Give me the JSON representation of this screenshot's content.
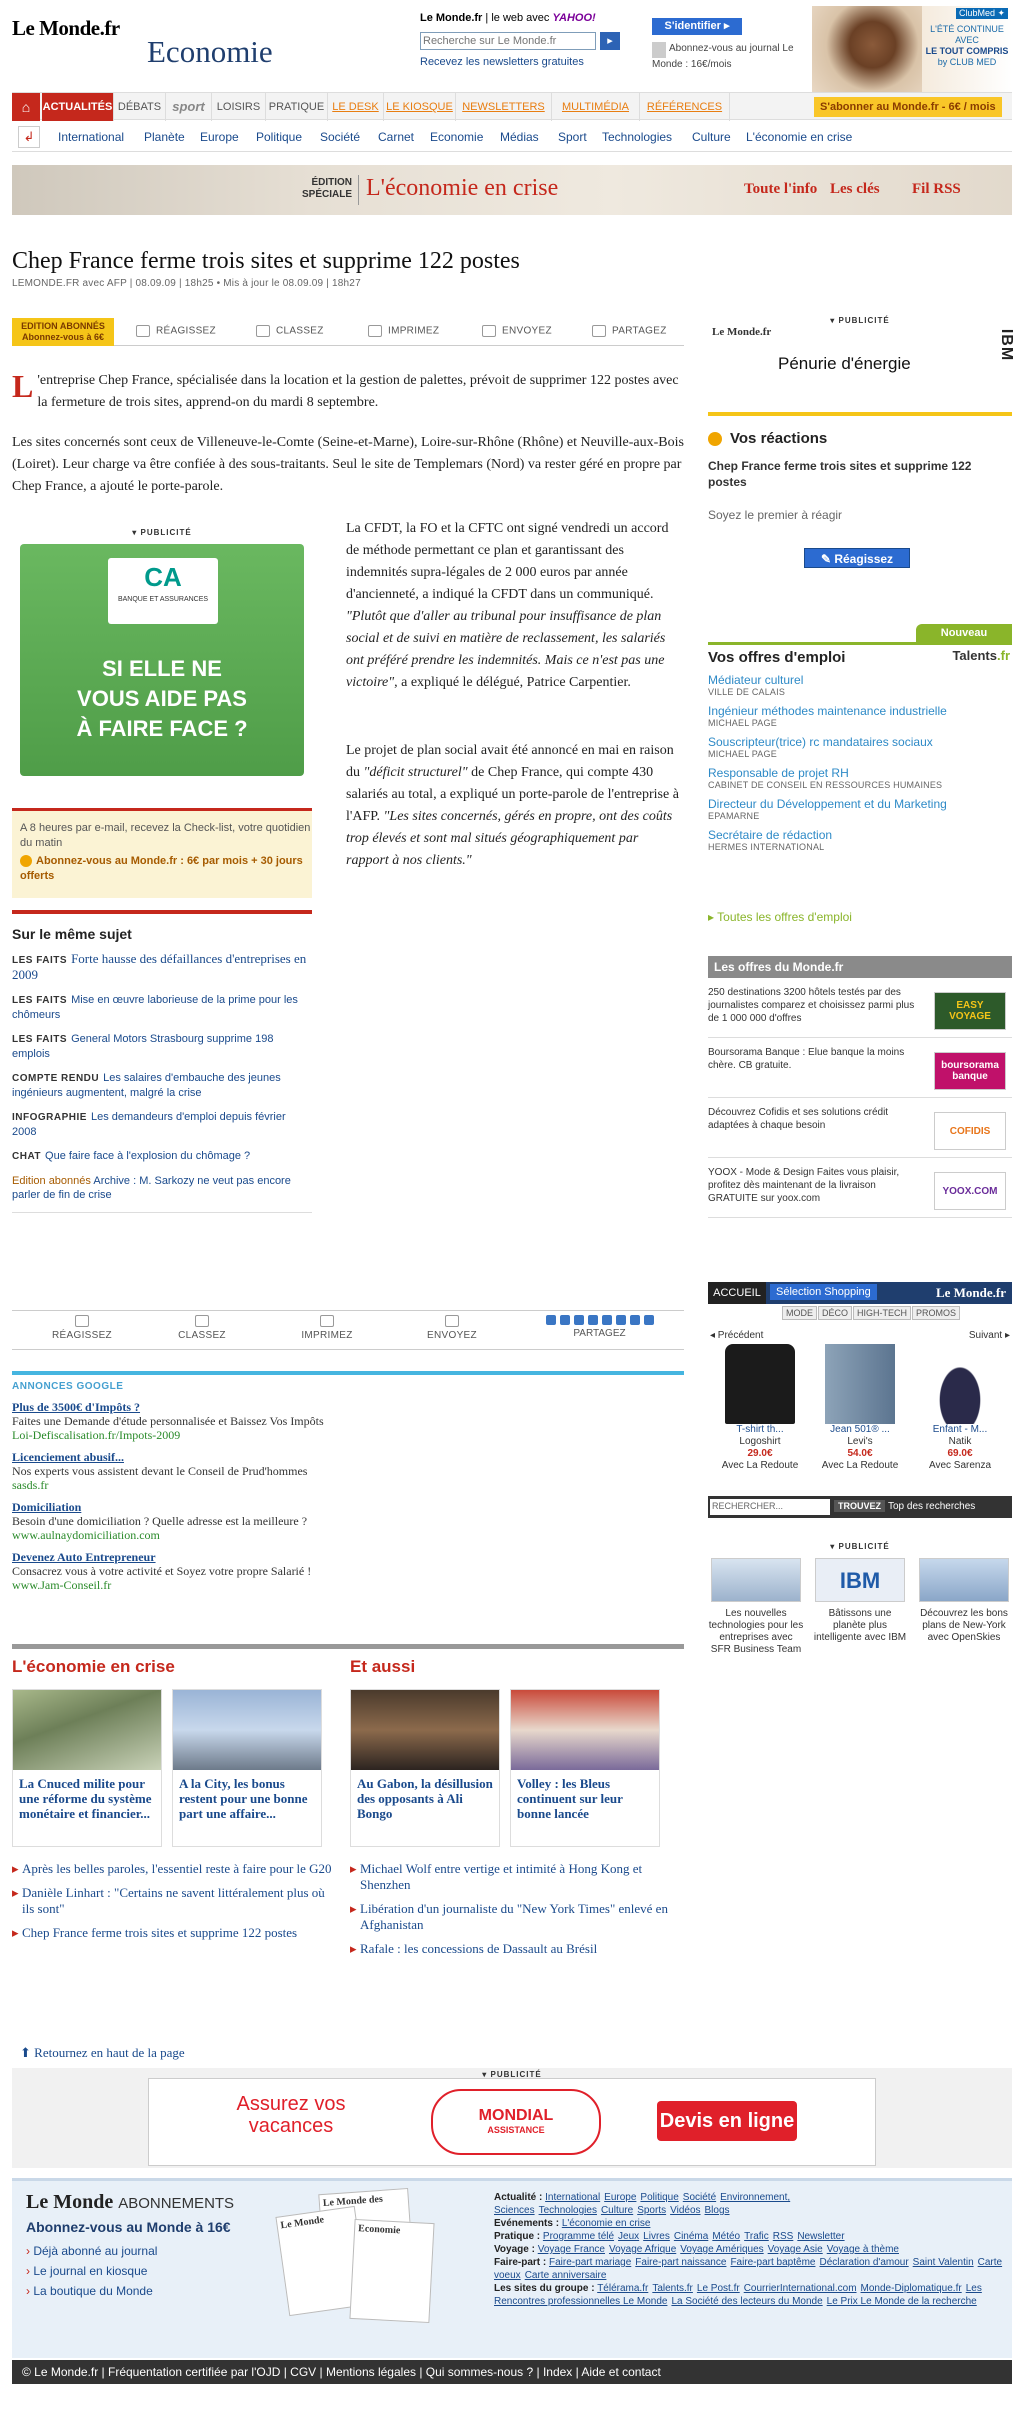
{
  "header": {
    "logo": "Le Monde.fr",
    "section": "Economie",
    "site_label": "Le Monde.fr",
    "web_label": "le web avec",
    "yahoo": "YAHOO!",
    "search_placeholder": "Recherche sur Le Monde.fr",
    "search_button": "▸",
    "newsletters": "Recevez les newsletters gratuites",
    "identify": "S'identifier ▸",
    "subscribe_text": "Abonnez-vous au journal Le Monde : 16€/mois",
    "ad": {
      "tag": "ClubMed ✦",
      "l1": "L'ÉTÉ CONTINUE",
      "l2": "AVEC",
      "l3": "LE TOUT COMPRIS",
      "l4": "by CLUB MED"
    }
  },
  "nav": {
    "home_icon": "⌂",
    "tabs": [
      "ACTUALITÉS",
      "DÉBATS",
      "sport",
      "LOISIRS",
      "PRATIQUE",
      "LE DESK",
      "LE KIOSQUE",
      "NEWSLETTERS",
      "MULTIMÉDIA",
      "RÉFÉRENCES"
    ],
    "subscribe": "S'abonner au Monde.fr - 6€ / mois"
  },
  "subnav": {
    "back_icon": "↲",
    "items": [
      "International",
      "Planète",
      "Europe",
      "Politique",
      "Société",
      "Carnet",
      "Economie",
      "Médias",
      "Sport",
      "Technologies",
      "Culture",
      "L'économie en crise"
    ]
  },
  "banner": {
    "edition": "ÉDITION SPÉCIALE",
    "title": "L'économie en crise",
    "links": [
      "Toute l'info",
      "Les clés",
      "Fil RSS"
    ]
  },
  "article": {
    "title": "Chep France ferme trois sites et supprime 122 postes",
    "byline": "LEMONDE.FR avec AFP | 08.09.09 | 18h25  •  Mis à jour le 08.09.09 | 18h27",
    "toolbar": {
      "edition": "EDITION ABONNÉS Abonnez-vous à 6€",
      "actions": [
        "RÉAGISSEZ",
        "CLASSEZ",
        "IMPRIMEZ",
        "ENVOYEZ",
        "PARTAGEZ"
      ]
    },
    "dropcap": "L",
    "p1": "'entreprise Chep France, spécialisée dans la location et la gestion de palettes, prévoit de supprimer 122 postes avec la fermeture de trois sites, apprend-on du mardi 8 septembre.",
    "p2": "Les sites concernés sont ceux de Villeneuve-le-Comte (Seine-et-Marne), Loire-sur-Rhône (Rhône) et Neuville-aux-Bois (Loiret). Leur charge va être confiée à des sous-traitants. Seul le site de Templemars (Nord) va rester géré en propre par Chep France, a ajouté le porte-parole.",
    "p3_a": "La CFDT, la FO et la CFTC ont signé vendredi un accord de méthode permettant ce plan et garantissant des indemnités supra-légales de 2 000 euros par année d'ancienneté, a indiqué la CFDT dans un communiqué. ",
    "p3_q": "\"Plutôt que d'aller au tribunal pour insuffisance de plan social et de suivi en matière de reclassement, les salariés ont préféré prendre les indemnités. Mais ce n'est pas une victoire\"",
    "p3_b": ", a expliqué le délégué, Patrice Carpentier.",
    "p4_a": "Le projet de plan social avait été annoncé en mai en raison du ",
    "p4_q1": "\"déficit structurel\"",
    "p4_b": " de Chep France, qui compte 430 salariés au total, a expliqué un porte-parole de l'entreprise à l'AFP. ",
    "p4_q2": "\"Les sites concernés, gérés en propre, ont des coûts trop élevés et sont mal situés géographiquement par rapport à nos clients.\""
  },
  "ad_ca": {
    "pub": "PUBLICITÉ",
    "logo": "CA",
    "logo_sub": "BANQUE ET ASSURANCES",
    "slogan_1": "SI ELLE NE",
    "slogan_2": "VOUS AIDE PAS",
    "slogan_3": "À FAIRE FACE ?"
  },
  "promo": {
    "text": "A 8 heures par e-mail, recevez la Check-list, votre quotidien du matin",
    "offer": "Abonnez-vous au Monde.fr : 6€ par mois + 30 jours offerts"
  },
  "same_subject": {
    "heading": "Sur le même sujet",
    "items": [
      {
        "kind": "LES FAITS",
        "text": "Forte hausse des défaillances d'entreprises en 2009"
      },
      {
        "kind": "LES FAITS",
        "text": "Mise en œuvre laborieuse de la prime pour les chômeurs"
      },
      {
        "kind": "LES FAITS",
        "text": "General Motors Strasbourg supprime 198 emplois"
      },
      {
        "kind": "COMPTE RENDU",
        "text": "Les salaires d'embauche des jeunes ingénieurs augmentent, malgré la crise"
      },
      {
        "kind": "INFOGRAPHIE",
        "text": "Les demandeurs d'emploi depuis février 2008"
      },
      {
        "kind": "CHAT",
        "text": "Que faire face à l'explosion du chômage ?"
      }
    ],
    "abonnes": "Edition abonnés",
    "abonnes_text": "Archive : M. Sarkozy ne veut pas encore parler de fin de crise"
  },
  "toolbar2": {
    "actions": [
      "RÉAGISSEZ",
      "CLASSEZ",
      "IMPRIMEZ",
      "ENVOYEZ"
    ],
    "share": "PARTAGEZ"
  },
  "google": {
    "heading": "ANNONCES GOOGLE",
    "ads": [
      {
        "title": "Plus de 3500€ d'Impôts ?",
        "text": "Faites une Demande d'étude personnalisée et Baissez Vos Impôts",
        "url": "Loi-Defiscalisation.fr/Impots-2009"
      },
      {
        "title": "Licenciement abusif...",
        "text": "Nos experts vous assistent devant le Conseil de Prud'hommes",
        "url": "sasds.fr"
      },
      {
        "title": "Domiciliation",
        "text": "Besoin d'une domiciliation ? Quelle adresse est la meilleure ?",
        "url": "www.aulnaydomiciliation.com"
      },
      {
        "title": "Devenez Auto Entrepreneur",
        "text": "Consacrez vous à votre activité et Soyez votre propre Salarié !",
        "url": "www.Jam-Conseil.fr"
      }
    ]
  },
  "bottom_news": {
    "eco_heading": "L'économie en crise",
    "aussi_heading": "Et aussi",
    "cards": [
      "La Cnuced milite pour une réforme du système monétaire et financier...",
      "A la City, les bonus restent pour une bonne part une affaire...",
      "Au Gabon, la désillusion des opposants à Ali Bongo",
      "Volley : les Bleus continuent sur leur bonne lancée"
    ],
    "eco_list": [
      "Après les belles paroles, l'essentiel reste à faire pour le G20",
      "Danièle Linhart : \"Certains ne savent littéralement plus où ils sont\"",
      "Chep France ferme trois sites et supprime 122 postes"
    ],
    "aussi_list": [
      "Michael Wolf entre vertige et intimité à Hong Kong et Shenzhen",
      "Libération d'un journaliste du \"New York Times\" enlevé en Afghanistan",
      "Rafale : les concessions de Dassault au Brésil"
    ]
  },
  "back_top": "Retournez en haut de la page",
  "bottom_ad": {
    "pub": "PUBLICITÉ",
    "left": "Assurez vos vacances",
    "brand": "MONDIAL",
    "brand_sub": "ASSISTANCE",
    "cta": "Devis en ligne"
  },
  "footer": {
    "logo": "Le Monde",
    "abonnements": "ABONNEMENTS",
    "offer": "Abonnez-vous au Monde à 16€",
    "links": [
      "Déjà abonné au journal",
      "Le journal en kiosque",
      "La boutique du Monde"
    ],
    "mag1": "Le Monde",
    "mag2": "Economie",
    "mag3": "Le Monde des Livres",
    "right": [
      {
        "label": "Actualité :",
        "links": [
          "International",
          "Europe",
          "Politique",
          "Société",
          "Environnement, Sciences",
          "Technologies",
          "Culture",
          "Sports",
          "Vidéos",
          "Blogs"
        ]
      },
      {
        "label": "Evénements :",
        "links": [
          "L'économie en crise"
        ]
      },
      {
        "label": "Pratique :",
        "links": [
          "Programme télé",
          "Jeux",
          "Livres",
          "Cinéma",
          "Météo",
          "Trafic",
          "RSS",
          "Newsletter"
        ]
      },
      {
        "label": "Voyage :",
        "links": [
          "Voyage France",
          "Voyage Afrique",
          "Voyage Amériques",
          "Voyage Asie",
          "Voyage à thème"
        ]
      },
      {
        "label": "Faire-part :",
        "links": [
          "Faire-part mariage",
          "Faire-part naissance",
          "Faire-part baptême",
          "Déclaration d'amour",
          "Saint Valentin",
          "Carte voeux",
          "Carte anniversaire"
        ]
      },
      {
        "label": "Les sites du groupe :",
        "links": [
          "Télérama.fr",
          "Talents.fr",
          "Le Post.fr",
          "CourrierInternational.com",
          "Monde-Diplomatique.fr",
          "Les Rencontres professionnelles Le Monde",
          "La Société des lecteurs du Monde",
          "Le Prix Le Monde de la recherche"
        ]
      }
    ]
  },
  "copyright": "© Le Monde.fr | Fréquentation certifiée par l'OJD | CGV | Mentions légales | Qui sommes-nous ? | Index | Aide et contact",
  "right": {
    "pub": "PUBLICITÉ",
    "energy_logo": "Le Monde.fr",
    "energy": "Pénurie d'énergie",
    "ibm": "IBM",
    "reactions": {
      "heading": "Vos réactions",
      "title": "Chep France ferme trois sites et supprime 122 postes",
      "sub": "Soyez le premier à réagir",
      "button": "Réagissez"
    },
    "jobs": {
      "new": "Nouveau",
      "heading": "Vos offres d'emploi",
      "talents": "Talents",
      "talents_ext": ".fr",
      "items": [
        {
          "title": "Médiateur culturel",
          "company": "VILLE DE CALAIS"
        },
        {
          "title": "Ingénieur méthodes maintenance industrielle",
          "company": "MICHAEL PAGE"
        },
        {
          "title": "Souscripteur(trice) rc mandataires sociaux",
          "company": "MICHAEL PAGE"
        },
        {
          "title": "Responsable de projet RH",
          "company": "CABINET DE CONSEIL EN RESSOURCES HUMAINES"
        },
        {
          "title": "Directeur du Développement et du Marketing",
          "company": "EPAMARNE"
        },
        {
          "title": "Secrétaire de rédaction",
          "company": "HERMES INTERNATIONAL"
        }
      ],
      "all": "Toutes les offres d'emploi"
    },
    "offres": {
      "heading": "Les offres du Monde.fr",
      "items": [
        {
          "text": "250 destinations 3200 hôtels testés par des journalistes comparez et choisissez parmi plus de 1 000 000 d'offres",
          "logo": "EASY VOYAGE"
        },
        {
          "text": "Boursorama Banque : Elue banque la moins chère. CB gratuite.",
          "logo": "boursorama banque"
        },
        {
          "text": "Découvrez Cofidis et ses solutions crédit adaptées à chaque besoin",
          "logo": "COFIDIS"
        },
        {
          "text": "YOOX - Mode & Design Faites vous plaisir, profitez dès maintenant de la livraison GRATUITE sur yoox.com",
          "logo": "YOOX.COM"
        }
      ]
    },
    "shop": {
      "accueil": "ACCUEIL",
      "selection": "Sélection Shopping",
      "logo": "Le Monde.fr",
      "cats": [
        "MODE",
        "DÉCO",
        "HIGH-TECH",
        "PROMOS"
      ],
      "prev": "◂ Précédent",
      "next": "Suivant ▸",
      "products": [
        {
          "name": "T-shirt th...",
          "brand": "Logoshirt",
          "price": "29.0€",
          "shop": "Avec La Redoute"
        },
        {
          "name": "Jean 501® ...",
          "brand": "Levi's",
          "price": "54.0€",
          "shop": "Avec La Redoute"
        },
        {
          "name": "Enfant - M...",
          "brand": "Natik",
          "price": "69.0€",
          "shop": "Avec Sarenza"
        }
      ],
      "search": "RECHERCHER...",
      "go": "TROUVEZ",
      "top": "Top des recherches"
    },
    "tiles": [
      "Les nouvelles technologies pour les entreprises avec SFR Business Team",
      "Bâtissons une planète plus intelligente avec IBM",
      "Découvrez les bons plans de New-York avec OpenSkies"
    ]
  }
}
